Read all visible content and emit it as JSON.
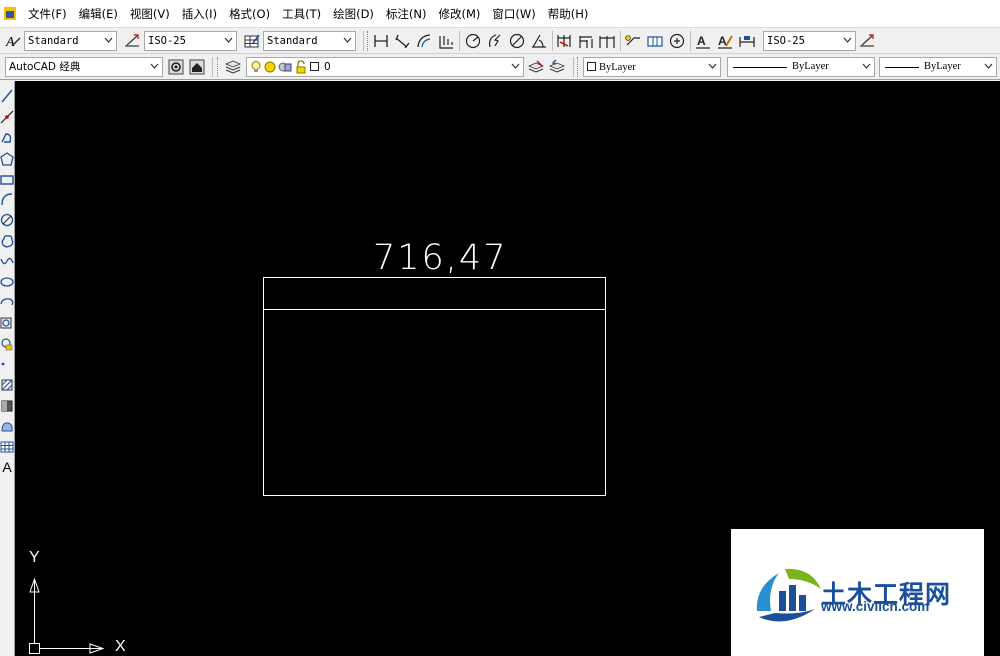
{
  "menu": [
    "文件(F)",
    "编辑(E)",
    "视图(V)",
    "插入(I)",
    "格式(O)",
    "工具(T)",
    "绘图(D)",
    "标注(N)",
    "修改(M)",
    "窗口(W)",
    "帮助(H)"
  ],
  "styles_toolbar": {
    "text_style": "Standard",
    "dim_style": "ISO-25",
    "table_style": "Standard",
    "multileader_style": "ISO-25"
  },
  "workspace_toolbar": {
    "workspace": "AutoCAD 经典",
    "layer": "0",
    "color": "ByLayer",
    "linetype": "ByLayer",
    "lineweight": "ByLayer"
  },
  "drawing": {
    "dimension_text": "716,47",
    "ucs_y": "Y",
    "ucs_x": "X",
    "color": "#ffffff",
    "background": "#000000"
  },
  "watermark": {
    "title": "土木工程网",
    "url": "www.civilcn.com",
    "brand_color": "#1b4f9c"
  }
}
